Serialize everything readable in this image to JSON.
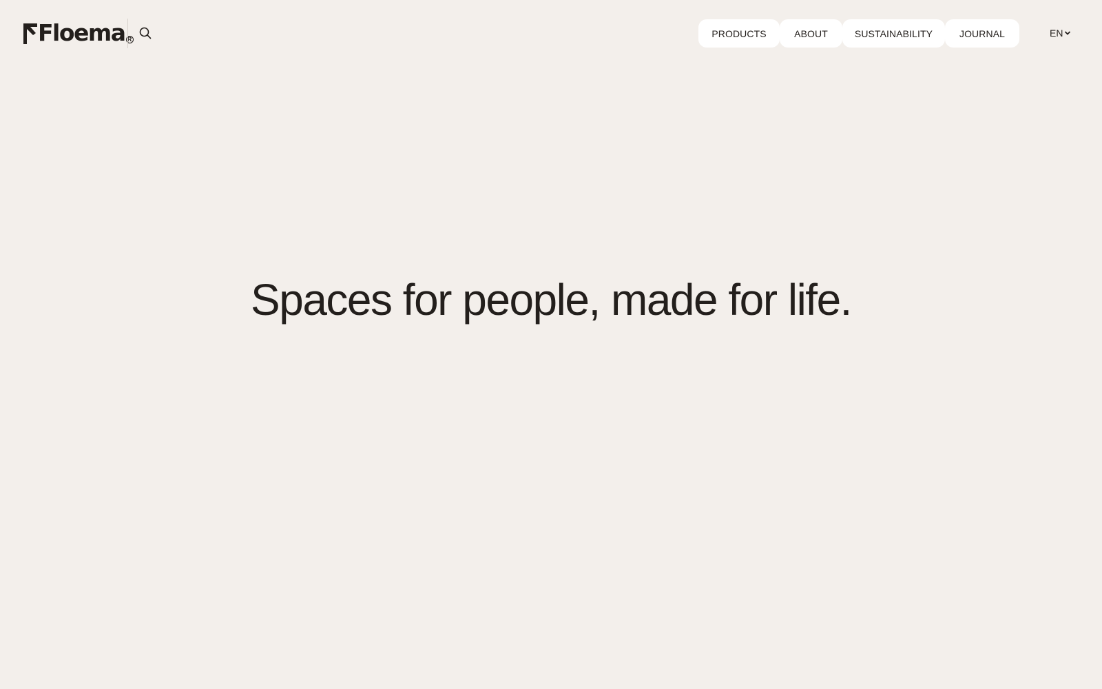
{
  "brand": {
    "name": "Floema",
    "registered_mark": "R"
  },
  "header": {
    "search_icon": "search-icon",
    "nav": [
      {
        "label": "PRODUCTS"
      },
      {
        "label": "ABOUT"
      },
      {
        "label": "SUSTAINABILITY"
      },
      {
        "label": "JOURNAL"
      }
    ],
    "language": {
      "selected": "EN",
      "icon": "chevron-down-icon"
    }
  },
  "hero": {
    "headline": "Spaces for people, made for life."
  },
  "colors": {
    "background": "#f3efeb",
    "text": "#231f1c",
    "pill": "#ffffff"
  }
}
